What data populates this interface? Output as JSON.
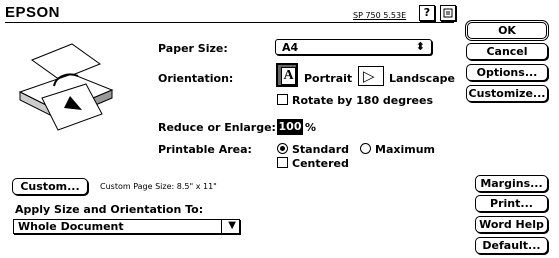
{
  "brand": "EPSON",
  "driver_version": "SP 750 5.53E",
  "buttons": {
    "ok": "OK",
    "cancel": "Cancel",
    "options": "Options...",
    "customize": "Customize...",
    "margins": "Margins...",
    "print": "Print...",
    "word_help": "Word Help",
    "default": "Default...",
    "custom": "Custom..."
  },
  "labels": {
    "paper_size": "Paper Size:",
    "orientation": "Orientation:",
    "reduce_enlarge": "Reduce or Enlarge:",
    "printable_area": "Printable Area:",
    "apply_to": "Apply Size and Orientation To:"
  },
  "paper_size_value": "A4",
  "orientation": {
    "portrait": "Portrait",
    "landscape": "Landscape",
    "selected": "Portrait"
  },
  "rotate_180": {
    "label": "Rotate by 180 degrees",
    "checked": false
  },
  "scale": {
    "value": "100",
    "unit": "%"
  },
  "printable_area": {
    "standard": "Standard",
    "maximum": "Maximum",
    "selected": "Standard",
    "centered_label": "Centered",
    "centered_checked": false
  },
  "custom_page_size": "Custom Page Size: 8.5\" x 11\"",
  "apply_to_value": "Whole Document"
}
